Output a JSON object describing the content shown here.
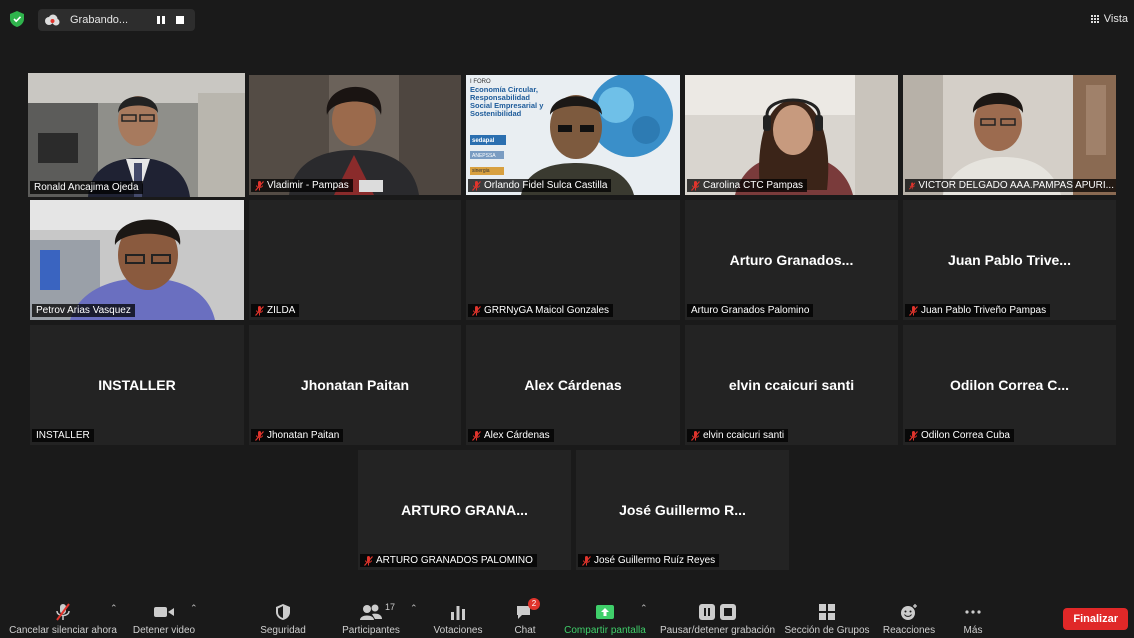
{
  "recording": {
    "label": "Grabando..."
  },
  "view": {
    "label": "Vista"
  },
  "participants": [
    {
      "name": "Ronald Ancajima Ojeda",
      "muted": false,
      "video": true,
      "active": true
    },
    {
      "name": "Vladimir - Pampas",
      "muted": true,
      "video": true
    },
    {
      "name": "Orlando Fidel Sulca Castilla",
      "muted": true,
      "video": true
    },
    {
      "name": "Carolina CTC Pampas",
      "muted": true,
      "video": true
    },
    {
      "name": "VICTOR DELGADO AAA.PAMPAS APURI...",
      "muted": true,
      "video": true
    },
    {
      "name": "Petrov Arias Vasquez",
      "muted": false,
      "video": true
    },
    {
      "name": "ZILDA",
      "muted": true,
      "video": false,
      "display": ""
    },
    {
      "name": "GRRNyGA Maicol Gonzales",
      "muted": true,
      "video": false,
      "display": ""
    },
    {
      "name": "Arturo Granados Palomino",
      "muted": false,
      "video": false,
      "display": "Arturo Granados..."
    },
    {
      "name": "Juan Pablo Triveño Pampas",
      "muted": true,
      "video": false,
      "display": "Juan Pablo Trive..."
    },
    {
      "name": "INSTALLER",
      "muted": false,
      "video": false,
      "display": "INSTALLER"
    },
    {
      "name": "Jhonatan Paitan",
      "muted": true,
      "video": false,
      "display": "Jhonatan Paitan"
    },
    {
      "name": "Alex Cárdenas",
      "muted": true,
      "video": false,
      "display": "Alex Cárdenas"
    },
    {
      "name": "elvin ccaicuri santi",
      "muted": true,
      "video": false,
      "display": "elvin ccaicuri santi"
    },
    {
      "name": "Odilon Correa Cuba",
      "muted": true,
      "video": false,
      "display": "Odilon Correa C..."
    },
    {
      "name": "ARTURO GRANADOS PALOMINO",
      "muted": true,
      "video": false,
      "display": "ARTURO GRANA..."
    },
    {
      "name": "José Guillermo Ruíz Reyes",
      "muted": true,
      "video": false,
      "display": "José Guillermo R..."
    }
  ],
  "slide": {
    "title": "Economía Circular, Responsabilidad Social Empresarial y Sostenibilidad",
    "tag": "I FORO",
    "logo1": "sedapal",
    "logo2": "ANEPSSA",
    "logo3": "sinergia"
  },
  "toolbar": {
    "mute": "Cancelar silenciar ahora",
    "video": "Detener video",
    "security": "Seguridad",
    "participants": "Participantes",
    "participants_count": "17",
    "polls": "Votaciones",
    "chat": "Chat",
    "chat_badge": "2",
    "share": "Compartir pantalla",
    "record": "Pausar/detener grabación",
    "breakout": "Sección de Grupos",
    "reactions": "Reacciones",
    "more": "Más",
    "end": "Finalizar"
  },
  "colors": {
    "active_border": "#c5d34a",
    "end": "#e02828",
    "share": "#3fcf6a",
    "muted_icon": "#e0342c"
  }
}
